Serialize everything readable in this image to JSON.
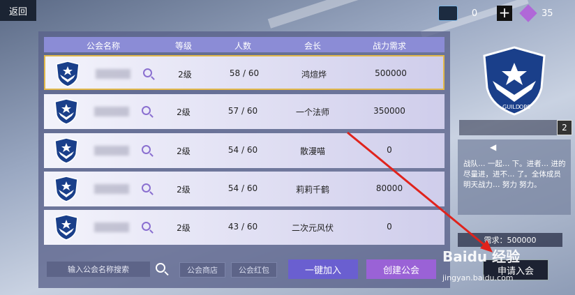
{
  "top": {
    "back_label": "返回",
    "currency_1_value": "0",
    "plus_label": "+",
    "currency_2_value": "35"
  },
  "table": {
    "columns": [
      "公会名称",
      "等级",
      "人数",
      "会长",
      "战力需求"
    ],
    "rows": [
      {
        "level": "2级",
        "members": "58 / 60",
        "leader": "鸿煊烨",
        "power": "500000",
        "selected": true
      },
      {
        "level": "2级",
        "members": "57 / 60",
        "leader": "一个法师",
        "power": "350000",
        "selected": false
      },
      {
        "level": "2级",
        "members": "54 / 60",
        "leader": "散漫喵",
        "power": "0",
        "selected": false
      },
      {
        "level": "2级",
        "members": "54 / 60",
        "leader": "莉莉千鹤",
        "power": "80000",
        "selected": false
      },
      {
        "level": "2级",
        "members": "43 / 60",
        "leader": "二次元风伏",
        "power": "0",
        "selected": false
      }
    ]
  },
  "bottom": {
    "search_placeholder": "输入公会名称搜索",
    "shop_label": "公会商店",
    "redpacket_label": "公会红包",
    "quick_join_label": "一键加入",
    "create_label": "创建公会"
  },
  "side": {
    "emblem_text_1": "GUILD",
    "emblem_text_2": "OPS",
    "level_badge": "2",
    "notice_text": "战队… 一起… 下。进者… 进的尽量进，进不… 了。全体成员明天战力… 努力 努力。",
    "requirement_label": "需求：500000",
    "apply_label": "申请入会"
  },
  "watermark": {
    "main": "Baidu 经验",
    "sub": "jingyan.baidu.com"
  },
  "colors": {
    "header_bg": "#8b8cd6",
    "selected_border": "#e2b84a",
    "quick_join_bg": "#6a5fd0",
    "create_bg": "#9a62d6",
    "arrow": "#e0231c"
  }
}
